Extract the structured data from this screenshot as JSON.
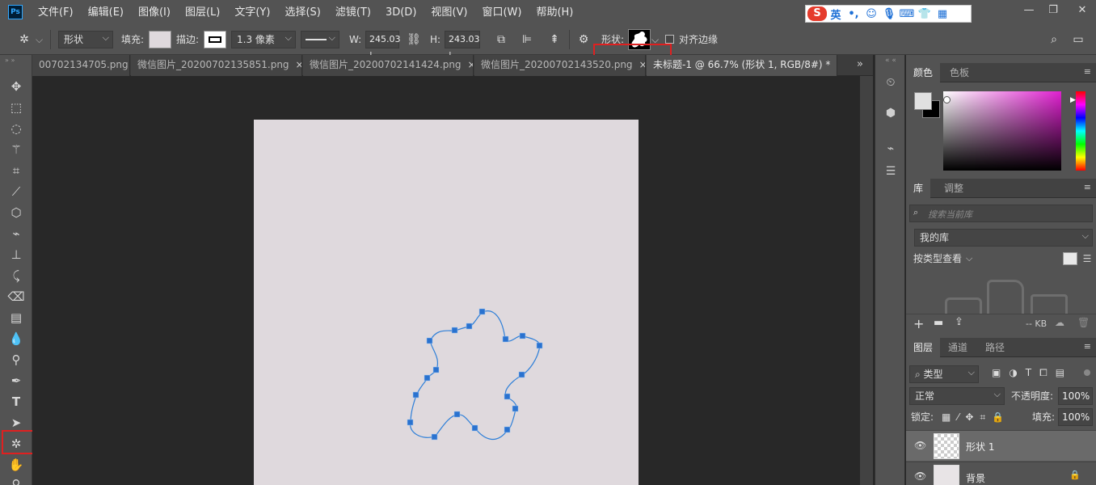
{
  "app": {
    "logo": "Ps"
  },
  "menu": [
    "文件(F)",
    "编辑(E)",
    "图像(I)",
    "图层(L)",
    "文字(Y)",
    "选择(S)",
    "滤镜(T)",
    "3D(D)",
    "视图(V)",
    "窗口(W)",
    "帮助(H)"
  ],
  "ime": {
    "logo": "S",
    "lang": "英",
    "icons": [
      "punctuation-icon",
      "emoji-icon",
      "microphone-icon",
      "keyboard-icon",
      "shirt-icon",
      "grid-icon"
    ]
  },
  "options": {
    "mode": "形状",
    "fill_label": "填充:",
    "stroke_label": "描边:",
    "stroke_width": "1.3 像素",
    "w_label": "W:",
    "w_value": "245.03 |",
    "h_label": "H:",
    "h_value": "243.03 |",
    "shape_label": "形状:",
    "align_edges_label": "对齐边缘",
    "fill_color": "#dfd9dd",
    "highlight_color": "#e02020"
  },
  "tabs": [
    {
      "label": "00702134705.png",
      "close": "×"
    },
    {
      "label": "微信图片_20200702135851.png",
      "close": "×"
    },
    {
      "label": "微信图片_20200702141424.png",
      "close": "×"
    },
    {
      "label": "微信图片_20200702143520.png",
      "close": "×"
    },
    {
      "label": "未标题-1 @ 66.7% (形状 1, RGB/8#) *",
      "close": "×"
    }
  ],
  "tab_overflow": "»",
  "panels": {
    "color": {
      "tabs": [
        "颜色",
        "色板"
      ],
      "fg": "#e0e0e0",
      "bg": "#000000"
    },
    "library": {
      "tabs": [
        "库",
        "调整"
      ],
      "search_placeholder": "搜索当前库",
      "my_library": "我的库",
      "view_by": "按类型查看",
      "size": "-- KB"
    },
    "layers": {
      "tabs": [
        "图层",
        "通道",
        "路径"
      ],
      "filter": "类型",
      "blend_mode": "正常",
      "opacity_label": "不透明度:",
      "opacity": "100%",
      "lock_label": "锁定:",
      "fill_label": "填充:",
      "fill": "100%",
      "items": [
        {
          "name": "形状 1"
        },
        {
          "name": "背景"
        }
      ]
    }
  }
}
